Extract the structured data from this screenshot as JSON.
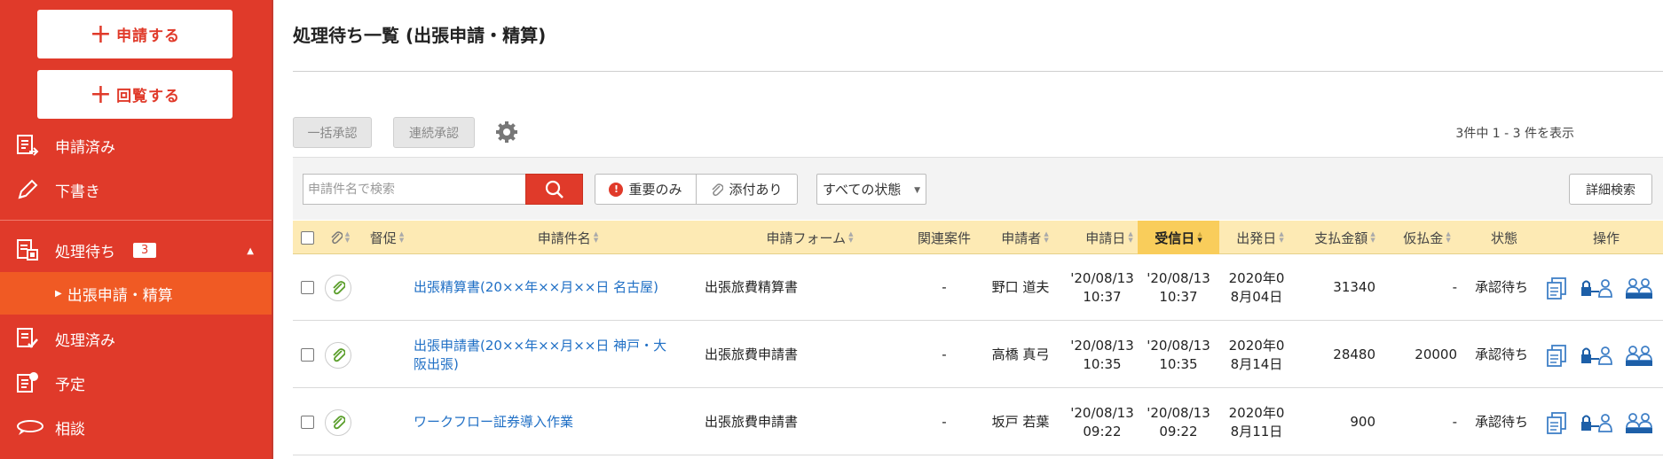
{
  "sidebar": {
    "apply_button": "申請する",
    "circulate_button": "回覧する",
    "nav": {
      "submitted": "申請済み",
      "drafts": "下書き",
      "pending": "処理待ち",
      "pending_count": "3",
      "pending_sub": "出張申請・精算",
      "processed": "処理済み",
      "schedule": "予定",
      "consult": "相談"
    }
  },
  "main": {
    "title": "処理待ち一覧 (出張申請・精算)",
    "bulk_approve": "一括承認",
    "sequential_approve": "連続承認",
    "count_text": "3件中 1 - 3 件を表示",
    "search_placeholder": "申請件名で検索",
    "filter_important": "重要のみ",
    "filter_attachment": "添付あり",
    "status_select": "すべての状態",
    "detail_search": "詳細検索"
  },
  "table": {
    "headers": {
      "reminder": "督促",
      "subject": "申請件名",
      "form": "申請フォーム",
      "related": "関連案件",
      "applicant": "申請者",
      "apply_date": "申請日",
      "received_date": "受信日",
      "departure_date": "出発日",
      "amount": "支払金額",
      "advance": "仮払金",
      "status": "状態",
      "actions": "操作"
    },
    "rows": [
      {
        "subject_line1": "出張精算書(20××年××月××日 名古屋)",
        "subject_line2": "",
        "form": "出張旅費精算書",
        "related": "-",
        "applicant": "野口 道夫",
        "apply_date_1": "'20/08/13",
        "apply_date_2": "10:37",
        "received_1": "'20/08/13",
        "received_2": "10:37",
        "departure_1": "2020年0",
        "departure_2": "8月04日",
        "amount": "31340",
        "advance": "-",
        "status": "承認待ち"
      },
      {
        "subject_line1": "出張申請書(20××年××月××日 神戸・大",
        "subject_line2": "阪出張)",
        "form": "出張旅費申請書",
        "related": "-",
        "applicant": "高橋 真弓",
        "apply_date_1": "'20/08/13",
        "apply_date_2": "10:35",
        "received_1": "'20/08/13",
        "received_2": "10:35",
        "departure_1": "2020年0",
        "departure_2": "8月14日",
        "amount": "28480",
        "advance": "20000",
        "status": "承認待ち"
      },
      {
        "subject_line1": "ワークフロー証券導入作業",
        "subject_line2": "",
        "form": "出張旅費申請書",
        "related": "-",
        "applicant": "坂戸 若葉",
        "apply_date_1": "'20/08/13",
        "apply_date_2": "09:22",
        "received_1": "'20/08/13",
        "received_2": "09:22",
        "departure_1": "2020年0",
        "departure_2": "8月11日",
        "amount": "900",
        "advance": "-",
        "status": "承認待ち"
      }
    ]
  },
  "colors": {
    "sidebar_red": "#e03a2a",
    "active_orange": "#f05a24",
    "header_yellow": "#fdeab4",
    "active_column": "#f9cd5b",
    "link_blue": "#1f6fc5",
    "attachment_green": "#5a9e2a"
  },
  "icons": [
    "plus-icon",
    "document-arrow-icon",
    "pencil-icon",
    "pending-docs-icon",
    "processed-icon",
    "schedule-icon",
    "consult-icon",
    "gear-icon",
    "search-icon",
    "exclamation-icon",
    "paperclip-icon",
    "copy-icon",
    "lock-person-icon",
    "group-icon"
  ]
}
